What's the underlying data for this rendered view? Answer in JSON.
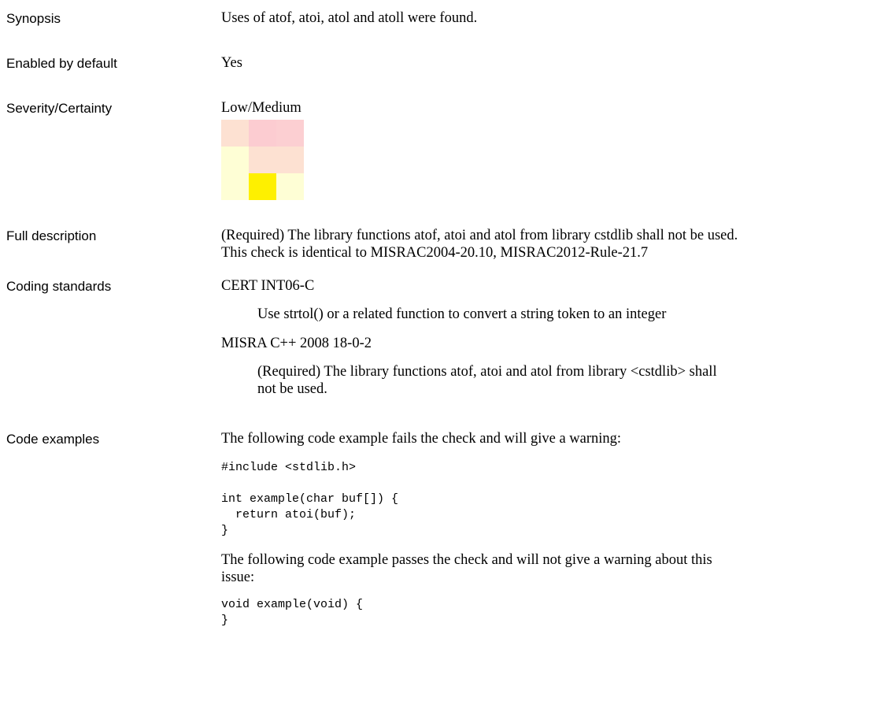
{
  "rows": {
    "synopsis": {
      "label": "Synopsis",
      "value": "Uses of atof, atoi, atol and atoll were found."
    },
    "enabled": {
      "label": "Enabled by default",
      "value": "Yes"
    },
    "severity": {
      "label": "Severity/Certainty",
      "value": "Low/Medium",
      "matrix_colors": [
        [
          "#fde1d2",
          "#fcccd1",
          "#fccfd2"
        ],
        [
          "#fefed5",
          "#fde1d2",
          "#fde1d2"
        ],
        [
          "#fefed5",
          "#fef000",
          "#fefed5"
        ]
      ]
    },
    "full_description": {
      "label": "Full description",
      "line1": "(Required) The library functions atof, atoi and atol from library cstdlib shall not be used.",
      "line2": "This check is identical to MISRAC2004-20.10, MISRAC2012-Rule-21.7"
    },
    "coding_standards": {
      "label": "Coding standards",
      "items": [
        {
          "name": "CERT INT06-C",
          "desc_line1": "Use strtol() or a related function to convert a string token to an integer",
          "desc_line2": ""
        },
        {
          "name": "MISRA C++ 2008 18-0-2",
          "desc_line1": "(Required) The library functions atof, atoi and atol from library <cstdlib> shall",
          "desc_line2": "not be used."
        }
      ]
    },
    "code_examples": {
      "label": "Code examples",
      "fail_intro": "The following code example fails the check and will give a warning:",
      "fail_code": "#include <stdlib.h>\n\nint example(char buf[]) {\n  return atoi(buf);\n}",
      "pass_intro_line1": "The following code example passes the check and will not give a warning about this",
      "pass_intro_line2": "issue:",
      "pass_code": "void example(void) {\n}"
    }
  }
}
